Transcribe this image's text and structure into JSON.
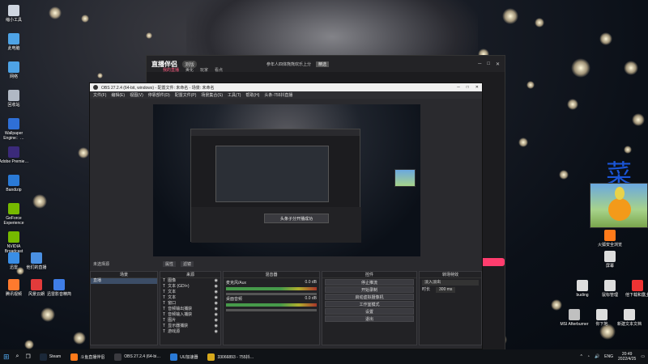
{
  "desktop": {
    "icons_left": [
      {
        "label": "缩小工具",
        "color": "#cfd6e0"
      },
      {
        "label": "此电脑",
        "color": "#4ea3e6"
      },
      {
        "label": "网络",
        "color": "#4ea3e6"
      },
      {
        "label": "回收站",
        "color": "#b0b8c4"
      },
      {
        "label": "Wallpaper Engine：…",
        "color": "#2f6fd6"
      },
      {
        "label": "Adobe Premie…",
        "color": "#3b2a7a"
      },
      {
        "label": "Bandizip",
        "color": "#2a7ad6"
      },
      {
        "label": "GeForce Experience",
        "color": "#76b900"
      },
      {
        "label": "NVIDIA Broadcast",
        "color": "#76b900"
      }
    ],
    "icons_row2": [
      {
        "label": "迅雷",
        "color": "#3a8ee6"
      },
      {
        "label": "他们的直播",
        "color": "#4a90e2"
      },
      {
        "label": "腾讯视频",
        "color": "#ff7a2e"
      },
      {
        "label": "风景云朗",
        "color": "#e23b3b"
      },
      {
        "label": "迅雷影音精简",
        "color": "#3f7de6"
      }
    ],
    "icons_right": [
      {
        "label": "火狐安全浏览",
        "color": "#ff7a1a"
      },
      {
        "label": "屏幕",
        "color": "#ddd"
      },
      {
        "label": "buding",
        "color": "#ddd"
      },
      {
        "label": "鼠标管理",
        "color": "#ddd"
      },
      {
        "label": "他下载和露土",
        "color": "#e33"
      },
      {
        "label": "MSI Afterburner",
        "color": "#c0c0c0"
      },
      {
        "label": "你下地",
        "color": "#ddd"
      },
      {
        "label": "新建文本文档",
        "color": "#ddd"
      }
    ],
    "overlay_char": "菜"
  },
  "zbhz": {
    "title": "直播伴侣",
    "version_badge": "测版",
    "tabs": [
      "我的直播",
      "美化",
      "玩家",
      "看点"
    ],
    "marquee": "参年人四体熊熊欢乐上分",
    "chip": "精选"
  },
  "obs": {
    "title": "OBS 27.2.4 (64-bit, windows) - 配置文件: 未命名 - 场景: 未命名",
    "menu": [
      "文件(F)",
      "编辑(E)",
      "视图(V)",
      "停靠部件(D)",
      "配置文件(P)",
      "场景集合(S)",
      "工具(T)",
      "帮助(H)",
      "头条-755抖直播"
    ],
    "scene_label": "未选择源",
    "scene_buttons": [
      "属性",
      "滤镜"
    ],
    "docks": {
      "scenes": {
        "title": "场景",
        "items": [
          "直播"
        ]
      },
      "sources": {
        "title": "来源",
        "items": [
          "图像",
          "文本 (GDI+)",
          "文本",
          "文本",
          "窗口",
          "音频输出捕获",
          "音频输入捕获",
          "图片",
          "显示器捕获",
          "游戏源"
        ]
      },
      "mixer": {
        "title": "混音器",
        "tracks": [
          {
            "name": "麦克风/Aux",
            "level": "0.0 dB"
          },
          {
            "name": "桌面音频",
            "level": "0.0 dB"
          }
        ]
      },
      "controls": {
        "title": "控件",
        "buttons": [
          "停止推流",
          "开始录制",
          "启动虚拟摄像机",
          "工作室模式",
          "设置",
          "退出"
        ]
      },
      "transitions": {
        "title": "转场特效",
        "type": "淡入淡出",
        "duration_label": "时长",
        "duration": "300 ms"
      }
    },
    "toast": "头条子分开播成功"
  },
  "taskbar": {
    "items": [
      "Steam",
      "斗鱼直播伴侣",
      "OBS 27.2.4 (64-bi…",
      "UU加速器",
      "33066893 - 755抖…"
    ],
    "tray_lang": "ENG",
    "time": "20:49",
    "date": "2022/4/25"
  }
}
